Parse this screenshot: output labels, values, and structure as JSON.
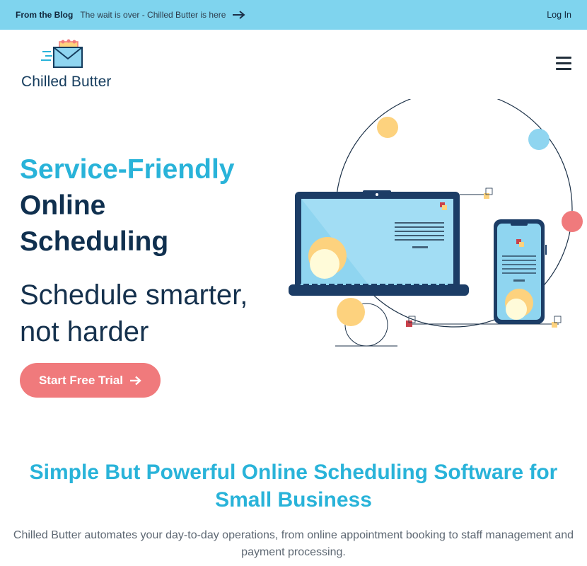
{
  "topbar": {
    "blog_label": "From the Blog",
    "blog_link": "The wait is over - Chilled Butter is here",
    "arrow_icon": "arrow-right-icon",
    "login": "Log In",
    "background": "#7fd4ee"
  },
  "header": {
    "logo_text": "Chilled Butter",
    "logo_icon": "envelope-calendar-icon",
    "menu_icon": "hamburger-menu-icon"
  },
  "hero": {
    "title_accent": "Service-Friendly",
    "title_line2": "Online",
    "title_line3": "Scheduling",
    "subtitle_line1": "Schedule smarter,",
    "subtitle_line2": "not harder",
    "cta_label": "Start Free Trial",
    "cta_icon": "arrow-right-icon",
    "illustration": "laptop-and-phone-scheduling-illustration"
  },
  "section": {
    "title_line1": "Simple But Powerful Online Scheduling Software for",
    "title_line2": "Small Business",
    "description": "Chilled Butter automates your day-to-day operations, from online appointment booking to staff management and payment processing."
  },
  "colors": {
    "accent_blue": "#29b3d9",
    "navy": "#10304f",
    "cta_coral": "#f07a7c",
    "yellow": "#fdd27e",
    "light_blue": "#8fd5f0"
  }
}
